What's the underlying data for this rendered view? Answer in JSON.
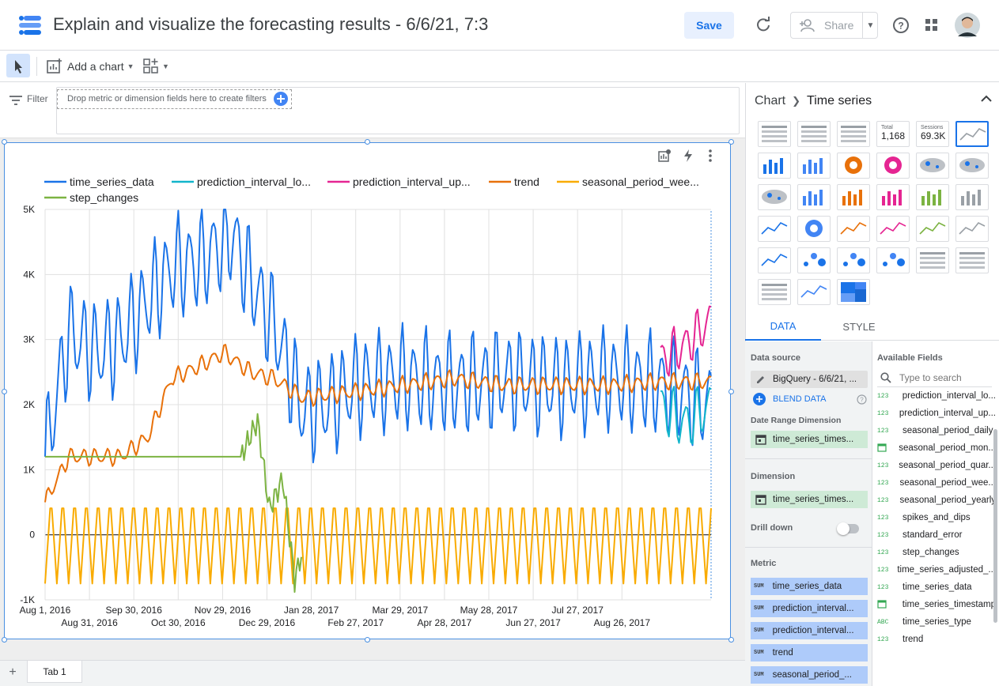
{
  "header": {
    "title": "Explain and visualize the forecasting results - 6/6/21, 7:3",
    "save_label": "Save",
    "share_label": "Share"
  },
  "toolbar": {
    "add_chart_label": "Add a chart"
  },
  "filter": {
    "label": "Filter",
    "drop_hint": "Drop metric or dimension fields here to create filters"
  },
  "chart": {
    "legend": [
      "time_series_data",
      "prediction_interval_lo...",
      "prediction_interval_up...",
      "trend",
      "seasonal_period_wee...",
      "step_changes"
    ],
    "colors": [
      "#1a73e8",
      "#12b5cb",
      "#e52592",
      "#e8710a",
      "#f9ab00",
      "#7cb342"
    ],
    "y_ticks": [
      "5K",
      "4K",
      "3K",
      "2K",
      "1K",
      "0",
      "-1K"
    ],
    "x_ticks_top": [
      "Aug 1, 2016",
      "Sep 30, 2016",
      "Nov 29, 2016",
      "Jan 28, 2017",
      "Mar 29, 2017",
      "May 28, 2017",
      "Jul 27, 2017"
    ],
    "x_ticks_bottom": [
      "Aug 31, 2016",
      "Oct 30, 2016",
      "Dec 29, 2016",
      "Feb 27, 2017",
      "Apr 28, 2017",
      "Jun 27, 2017",
      "Aug 26, 2017"
    ]
  },
  "chart_data": {
    "type": "line",
    "x_range": [
      "Aug 1, 2016",
      "Aug 31, 2017"
    ],
    "ylim": [
      -1000,
      5000
    ],
    "grid": true,
    "legend_position": "top",
    "series": [
      {
        "name": "time_series_data",
        "samples": [
          [
            "Aug 1, 2016",
            1200
          ],
          [
            "Aug 15, 2016",
            3100
          ],
          [
            "Sep 1, 2016",
            2800
          ],
          [
            "Sep 15, 2016",
            3000
          ],
          [
            "Oct 1, 2016",
            3600
          ],
          [
            "Oct 15, 2016",
            4100
          ],
          [
            "Nov 1, 2016",
            4200
          ],
          [
            "Nov 20, 2016",
            4600
          ],
          [
            "Dec 1, 2016",
            3900
          ],
          [
            "Dec 15, 2016",
            3200
          ],
          [
            "Jan 1, 2017",
            1900
          ],
          [
            "Jan 15, 2017",
            2000
          ],
          [
            "Feb 1, 2017",
            2300
          ],
          [
            "Mar 1, 2017",
            2400
          ],
          [
            "Apr 1, 2017",
            2300
          ],
          [
            "May 1, 2017",
            2400
          ],
          [
            "Jun 1, 2017",
            2300
          ],
          [
            "Jul 1, 2017",
            2400
          ],
          [
            "Aug 1, 2017",
            2300
          ],
          [
            "Aug 31, 2017",
            2000
          ]
        ]
      },
      {
        "name": "prediction_interval_lo...",
        "samples": [
          [
            "Aug 1, 2017",
            2000
          ],
          [
            "Aug 15, 2017",
            1700
          ],
          [
            "Aug 31, 2017",
            2000
          ]
        ]
      },
      {
        "name": "prediction_interval_up...",
        "samples": [
          [
            "Aug 1, 2017",
            2700
          ],
          [
            "Aug 15, 2017",
            2900
          ],
          [
            "Aug 31, 2017",
            3300
          ]
        ]
      },
      {
        "name": "trend",
        "samples": [
          [
            "Aug 1, 2016",
            500
          ],
          [
            "Aug 15, 2016",
            1200
          ],
          [
            "Sep 15, 2016",
            1200
          ],
          [
            "Oct 1, 2016",
            1500
          ],
          [
            "Oct 15, 2016",
            2400
          ],
          [
            "Nov 1, 2016",
            2600
          ],
          [
            "Nov 15, 2016",
            2800
          ],
          [
            "Dec 1, 2016",
            2500
          ],
          [
            "Dec 15, 2016",
            2400
          ],
          [
            "Jan 1, 2017",
            2100
          ],
          [
            "Feb 1, 2017",
            2200
          ],
          [
            "Mar 1, 2017",
            2300
          ],
          [
            "Apr 1, 2017",
            2400
          ],
          [
            "May 1, 2017",
            2300
          ],
          [
            "Jun 1, 2017",
            2300
          ],
          [
            "Jul 1, 2017",
            2300
          ],
          [
            "Aug 1, 2017",
            2350
          ],
          [
            "Aug 31, 2017",
            2350
          ]
        ]
      },
      {
        "name": "seasonal_period_wee...",
        "samples": [
          [
            "Aug 1, 2016",
            300
          ],
          [
            "Aug 31, 2017",
            300
          ]
        ],
        "oscillation": [
          -750,
          600
        ]
      },
      {
        "name": "step_changes",
        "samples": [
          [
            "Aug 1, 2016",
            1200
          ],
          [
            "Nov 25, 2016",
            1200
          ],
          [
            "Dec 5, 2016",
            1750
          ],
          [
            "Dec 12, 2016",
            400
          ],
          [
            "Dec 20, 2016",
            850
          ],
          [
            "Dec 27, 2016",
            -700
          ],
          [
            "Dec 31, 2016",
            -300
          ]
        ]
      }
    ]
  },
  "panel": {
    "breadcrumb_root": "Chart",
    "breadcrumb_current": "Time series",
    "scorecard_total_label": "Total",
    "scorecard_total_value": "1,168",
    "scorecard_sessions_label": "Sessions",
    "scorecard_sessions_value": "69.3K",
    "tab_data": "DATA",
    "tab_style": "STYLE",
    "data_source_label": "Data source",
    "data_source_value": "BigQuery - 6/6/21, ...",
    "blend_label": "BLEND DATA",
    "date_range_label": "Date Range Dimension",
    "date_range_value": "time_series_times...",
    "dimension_label": "Dimension",
    "dimension_value": "time_series_times...",
    "drill_label": "Drill down",
    "metric_label": "Metric",
    "metric_sum": "SUM",
    "metrics": [
      "time_series_data",
      "prediction_interval...",
      "prediction_interval...",
      "trend",
      "seasonal_period_..."
    ],
    "available_label": "Available Fields",
    "search_placeholder": "Type to search",
    "fields": [
      {
        "type": "123",
        "name": "prediction_interval_lo..."
      },
      {
        "type": "123",
        "name": "prediction_interval_up..."
      },
      {
        "type": "123",
        "name": "seasonal_period_daily"
      },
      {
        "type": "cal",
        "name": "seasonal_period_mon..."
      },
      {
        "type": "123",
        "name": "seasonal_period_quar..."
      },
      {
        "type": "123",
        "name": "seasonal_period_wee..."
      },
      {
        "type": "123",
        "name": "seasonal_period_yearly"
      },
      {
        "type": "123",
        "name": "spikes_and_dips"
      },
      {
        "type": "123",
        "name": "standard_error"
      },
      {
        "type": "123",
        "name": "step_changes"
      },
      {
        "type": "123",
        "name": "time_series_adjusted_..."
      },
      {
        "type": "123",
        "name": "time_series_data"
      },
      {
        "type": "cal",
        "name": "time_series_timestamp"
      },
      {
        "type": "ABC",
        "name": "time_series_type"
      },
      {
        "type": "123",
        "name": "trend"
      }
    ]
  },
  "tabs": {
    "add": "+",
    "page": "Tab 1"
  }
}
